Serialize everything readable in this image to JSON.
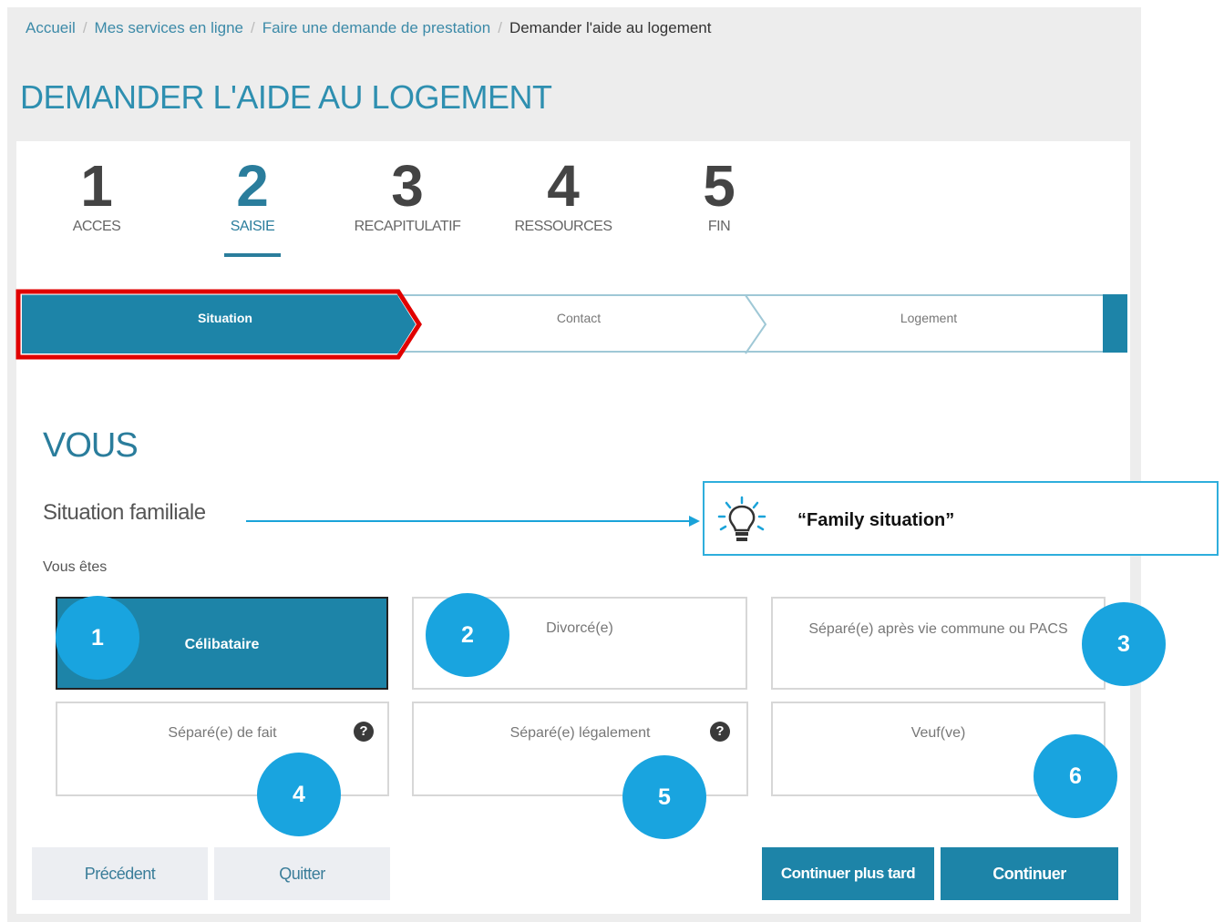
{
  "breadcrumb": {
    "items": [
      "Accueil",
      "Mes services en ligne",
      "Faire une demande de prestation"
    ],
    "separator": "/",
    "current": "Demander l'aide au logement"
  },
  "page_title": "DEMANDER L'AIDE AU LOGEMENT",
  "steps": [
    {
      "num": "1",
      "label": "ACCES"
    },
    {
      "num": "2",
      "label": "SAISIE"
    },
    {
      "num": "3",
      "label": "RECAPITULATIF"
    },
    {
      "num": "4",
      "label": "RESSOURCES"
    },
    {
      "num": "5",
      "label": "FIN"
    }
  ],
  "active_step": 2,
  "progress": {
    "segments": [
      "Situation",
      "Contact",
      "Logement"
    ],
    "active": "Situation"
  },
  "section": {
    "title": "VOUS",
    "subtitle": "Situation familiale",
    "question": "Vous êtes"
  },
  "callout": {
    "text": "“Family situation”",
    "icon": "lightbulb-icon"
  },
  "options": [
    {
      "label": "Célibataire",
      "selected": true,
      "help": false,
      "badge": "1"
    },
    {
      "label": "Divorcé(e)",
      "selected": false,
      "help": false,
      "badge": "2"
    },
    {
      "label": "Séparé(e) après vie commune ou PACS",
      "selected": false,
      "help": false,
      "badge": "3"
    },
    {
      "label": "Séparé(e) de fait",
      "selected": false,
      "help": true,
      "badge": "4"
    },
    {
      "label": "Séparé(e) légalement",
      "selected": false,
      "help": true,
      "badge": "5"
    },
    {
      "label": "Veuf(ve)",
      "selected": false,
      "help": false,
      "badge": "6"
    }
  ],
  "buttons": {
    "previous": "Précédent",
    "quit": "Quitter",
    "continue_later": "Continuer plus tard",
    "continue": "Continuer"
  },
  "colors": {
    "primary": "#1d84a8",
    "title": "#2a7d9c",
    "highlight_border": "#e00000",
    "badge": "#19a4df",
    "callout_border": "#2eaedc"
  }
}
